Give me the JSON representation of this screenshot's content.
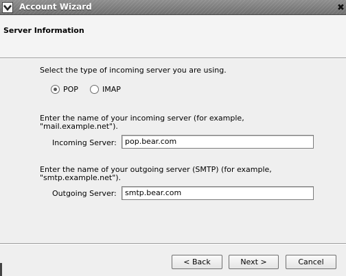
{
  "window": {
    "title": "Account Wizard",
    "close_glyph": "✖"
  },
  "header": {
    "title": "Server Information"
  },
  "server_type": {
    "prompt": "Select the type of incoming server you are using.",
    "options": [
      {
        "label": "POP",
        "selected": true
      },
      {
        "label": "IMAP",
        "selected": false
      }
    ]
  },
  "incoming": {
    "description_line1": "Enter the name of your incoming server (for example,",
    "description_line2": "\"mail.example.net\").",
    "label": "Incoming Server:",
    "value": "pop.bear.com"
  },
  "outgoing": {
    "description_line1": "Enter the name of your outgoing server (SMTP) (for example,",
    "description_line2": "\"smtp.example.net\").",
    "label": "Outgoing Server:",
    "value": "smtp.bear.com"
  },
  "buttons": {
    "back": "< Back",
    "next": "Next >",
    "cancel": "Cancel"
  },
  "icons": {
    "menu": "chevron-down-icon",
    "close": "close-icon"
  }
}
